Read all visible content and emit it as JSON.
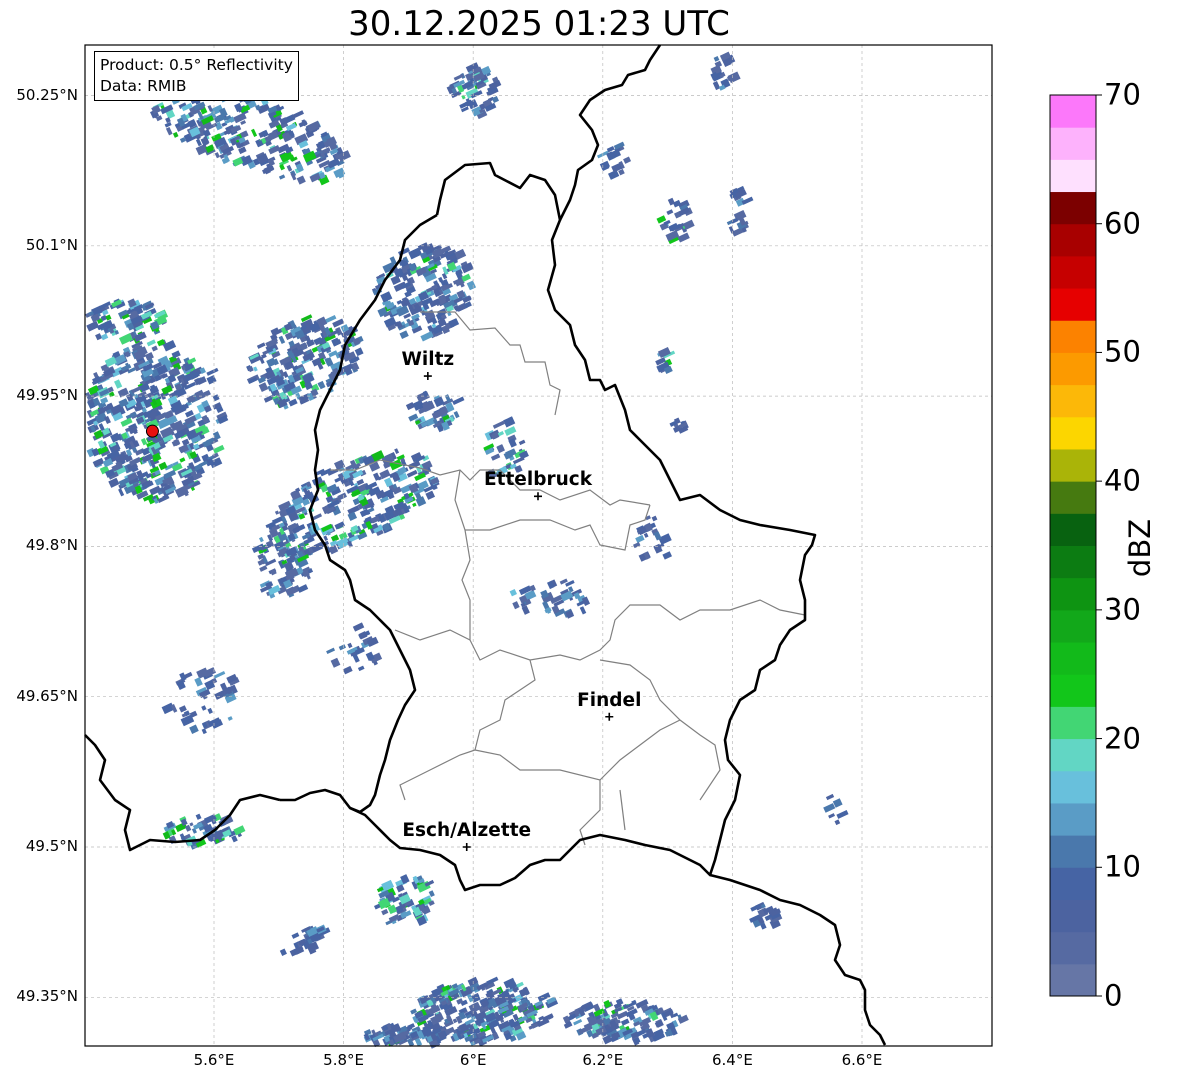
{
  "title": "30.12.2025 01:23 UTC",
  "info": {
    "product": "Product: 0.5° Reflectivity",
    "data_source": "Data: RMIB"
  },
  "axes": {
    "lat_ticks": [
      "50.25°N",
      "50.1°N",
      "49.95°N",
      "49.8°N",
      "49.65°N",
      "49.5°N",
      "49.35°N"
    ],
    "lon_ticks": [
      "5.6°E",
      "5.8°E",
      "6°E",
      "6.2°E",
      "6.4°E",
      "6.6°E"
    ]
  },
  "cities": [
    {
      "name": "Wiltz",
      "lon": 5.93,
      "lat": 49.97
    },
    {
      "name": "Ettelbruck",
      "lon": 6.1,
      "lat": 49.85
    },
    {
      "name": "Findel",
      "lon": 6.21,
      "lat": 49.63
    },
    {
      "name": "Esch/Alzette",
      "lon": 5.99,
      "lat": 49.5
    }
  ],
  "radar_site": {
    "lon": 5.505,
    "lat": 49.915,
    "color": "#e81010"
  },
  "colorbar": {
    "label": "dBZ",
    "ticks": [
      "0",
      "10",
      "20",
      "30",
      "40",
      "50",
      "60",
      "70"
    ],
    "min": 0,
    "max": 70,
    "step": 2.5,
    "colors": [
      "#6676a6",
      "#566aa2",
      "#4c63a0",
      "#4664a4",
      "#4a78ac",
      "#5a9cc6",
      "#68c0dc",
      "#62d6c4",
      "#42d674",
      "#12c61a",
      "#12ba1a",
      "#12a81a",
      "#0e9412",
      "#0c7c12",
      "#086210",
      "#467a10",
      "#aab408",
      "#fcd600",
      "#fcb808",
      "#fc9a00",
      "#fc8200",
      "#e60000",
      "#c60000",
      "#a80000",
      "#7c0000",
      "#fee0fe",
      "#fdb2fc",
      "#fc78fa",
      "#e838ec"
    ]
  },
  "map_colors": {
    "border": "#000000",
    "cantons": "#808080",
    "grid": "#bbbbbb"
  }
}
